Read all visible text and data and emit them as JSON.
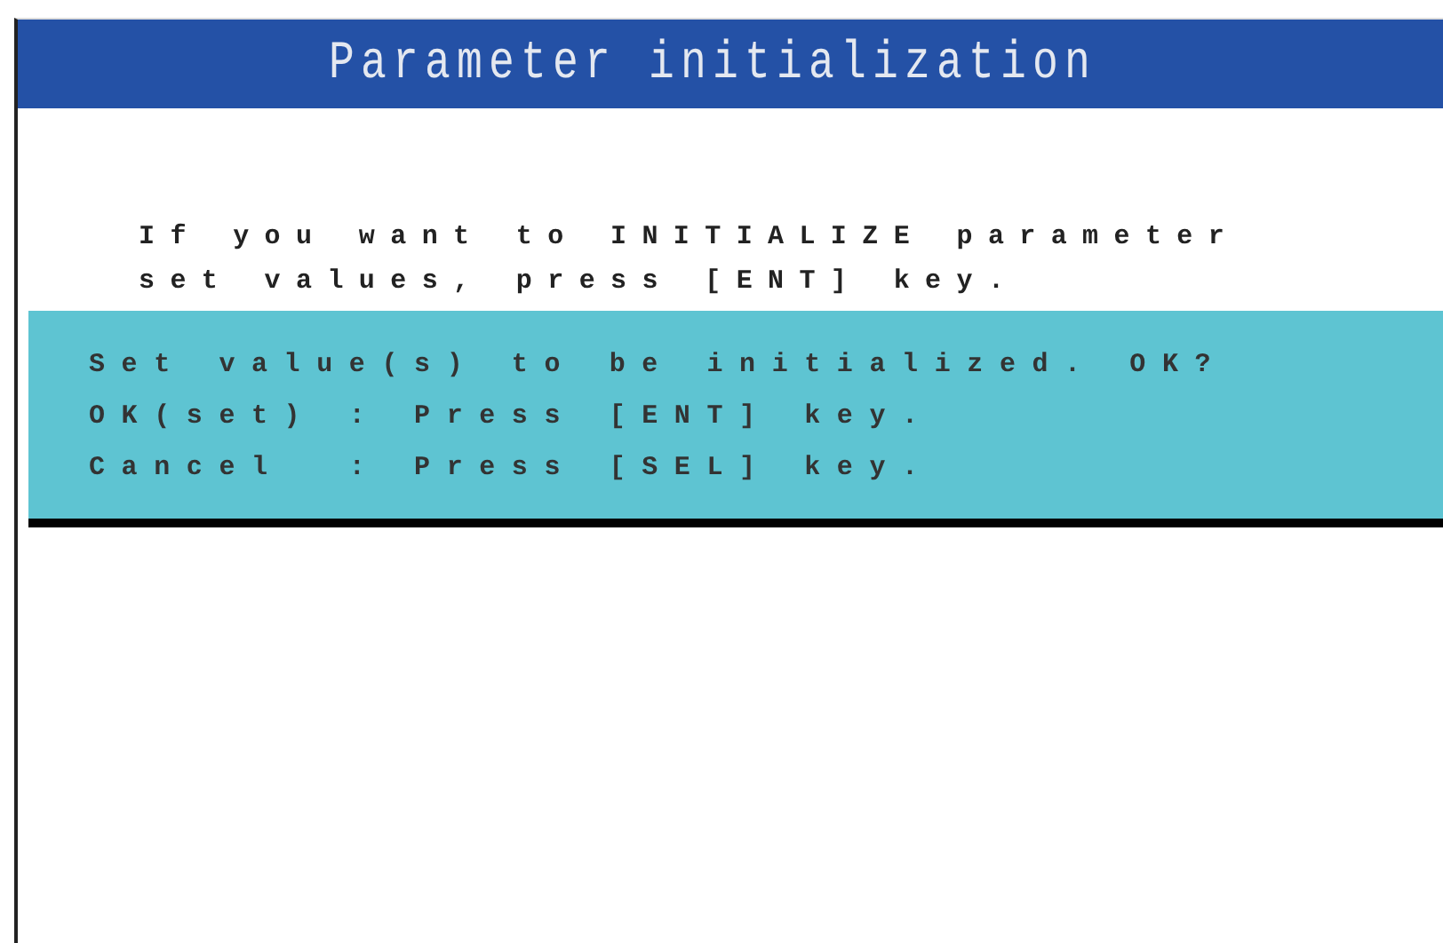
{
  "title_bar": {
    "title": "Parameter initialization"
  },
  "message": {
    "lines": [
      "If you want to INITIALIZE parameter",
      "set values, press [ENT] key."
    ]
  },
  "dialog": {
    "lines": [
      "Set value(s) to be initialized. OK?",
      "OK(set) : Press [ENT] key.",
      "Cancel  : Press [SEL] key."
    ]
  }
}
